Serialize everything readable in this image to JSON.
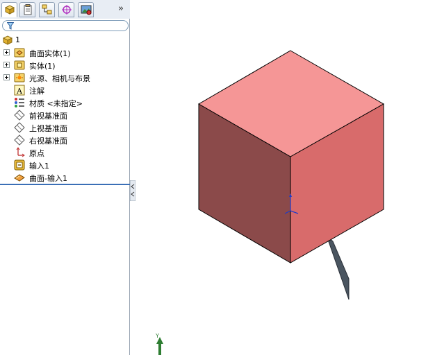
{
  "panel": {
    "tabs": [
      {
        "name": "feature-manager-tab",
        "icon": "feature-tree-icon",
        "active": true
      },
      {
        "name": "property-manager-tab",
        "icon": "property-manager-icon"
      },
      {
        "name": "configuration-manager-tab",
        "icon": "configuration-manager-icon"
      },
      {
        "name": "dimxpert-manager-tab",
        "icon": "dimxpert-target-icon"
      },
      {
        "name": "display-manager-tab",
        "icon": "display-manager-icon"
      }
    ],
    "more_label": "»",
    "filter": {
      "value": "",
      "icon": "filter-funnel-icon"
    }
  },
  "tree": {
    "root": {
      "label": "1",
      "icon": "part-icon"
    },
    "items": [
      {
        "label": "曲面实体(1)",
        "icon": "surface-bodies-folder-icon",
        "expandable": true
      },
      {
        "label": "实体(1)",
        "icon": "solid-bodies-folder-icon",
        "expandable": true
      },
      {
        "label": "光源、相机与布景",
        "icon": "lights-cameras-scene-icon",
        "expandable": true
      },
      {
        "label": "注解",
        "icon": "annotations-icon",
        "expandable": false
      },
      {
        "label": "材质 <未指定>",
        "icon": "material-icon",
        "expandable": false
      },
      {
        "label": "前视基准面",
        "icon": "plane-icon",
        "expandable": false
      },
      {
        "label": "上视基准面",
        "icon": "plane-icon",
        "expandable": false
      },
      {
        "label": "右视基准面",
        "icon": "plane-icon",
        "expandable": false
      },
      {
        "label": "原点",
        "icon": "origin-icon",
        "expandable": false
      },
      {
        "label": "输入1",
        "icon": "imported-body-icon",
        "expandable": false
      },
      {
        "label": "曲面-输入1",
        "icon": "surface-import-icon",
        "expandable": false
      }
    ]
  },
  "viewport": {
    "triad_axis_label": "Y",
    "colors": {
      "cube_top": "#f59696",
      "cube_left": "#8b4a4a",
      "cube_right": "#d86b6b",
      "sheet": "#4a5560",
      "triad": "#2e7d32",
      "origin": "#1e3cc8"
    }
  }
}
